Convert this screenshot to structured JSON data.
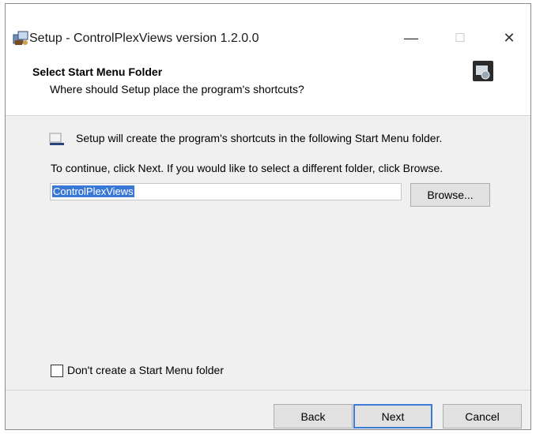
{
  "window": {
    "title": "Setup - ControlPlexViews version 1.2.0.0",
    "controls": {
      "minimize": "—",
      "maximize": "☐",
      "close": "✕"
    }
  },
  "header": {
    "title": "Select Start Menu Folder",
    "subtitle": "Where should Setup place the program's shortcuts?"
  },
  "body": {
    "line1": "Setup will create the program's shortcuts in the following Start Menu folder.",
    "line2": "To continue, click Next. If you would like to select a different folder, click Browse.",
    "folder_value": "ControlPlexViews",
    "browse_label": "Browse...",
    "checkbox_label": "Don't create a Start Menu folder",
    "checkbox_checked": false
  },
  "footer": {
    "back_label": "Back",
    "next_label": "Next",
    "cancel_label": "Cancel"
  },
  "icons": {
    "app": "setup-app-icon",
    "header": "installer-box-icon",
    "folder": "start-menu-folder-icon"
  }
}
